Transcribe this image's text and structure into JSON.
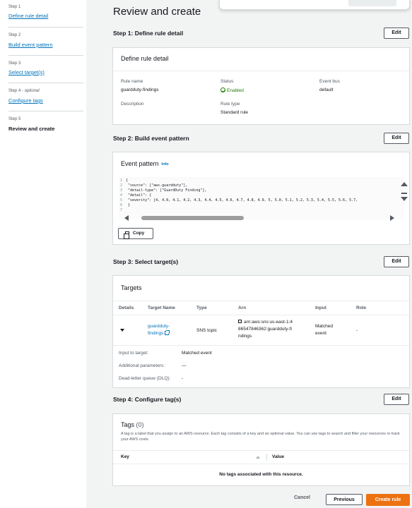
{
  "sidebar": {
    "steps": [
      {
        "num": "Step 1",
        "optional": "",
        "label": "Define rule detail"
      },
      {
        "num": "Step 2",
        "optional": "",
        "label": "Build event pattern"
      },
      {
        "num": "Step 3",
        "optional": "",
        "label": "Select target(s)"
      },
      {
        "num": "Step 4 - ",
        "optional": "optional",
        "label": "Configure tags"
      },
      {
        "num": "Step 5",
        "optional": "",
        "label": "Review and create"
      }
    ]
  },
  "page": {
    "title": "Review and create"
  },
  "edit_label": "Edit",
  "step1": {
    "title": "Step 1: Define rule detail",
    "panel_title": "Define rule detail",
    "rule_name_label": "Rule name",
    "rule_name": "guardduty-findings",
    "status_label": "Status",
    "status": "Enabled",
    "event_bus_label": "Event bus",
    "event_bus": "default",
    "description_label": "Description",
    "rule_type_label": "Rule type",
    "rule_type": "Standard rule"
  },
  "step2": {
    "title": "Step 2: Build event pattern",
    "panel_title": "Event pattern",
    "info": "Info",
    "copy_label": "Copy",
    "code": [
      {
        "n": "1",
        "text": "{"
      },
      {
        "n": "2",
        "text": "  \"source\": [\"aws.guardduty\"],"
      },
      {
        "n": "3",
        "text": "  \"detail-type\": [\"GuardDuty Finding\"],"
      },
      {
        "n": "4",
        "text": "  \"detail\": {"
      },
      {
        "n": "5",
        "text": "    \"severity\": [4, 4.0, 4.1, 4.2, 4.3, 4.4, 4.5, 4.6, 4.7, 4.8, 4.9, 5, 5.0, 5.1, 5.2, 5.3, 5.4, 5.5, 5.6, 5.7,"
      },
      {
        "n": "6",
        "text": "  }"
      },
      {
        "n": "7",
        "text": ""
      }
    ]
  },
  "step3": {
    "title": "Step 3: Select target(s)",
    "panel_title": "Targets",
    "columns": [
      "Details",
      "Target Name",
      "Type",
      "Arn",
      "Input",
      "Role"
    ],
    "row": {
      "target_name_1": "guardduty-",
      "target_name_2": "findings",
      "type": "SNS topic",
      "arn_1": "arn:aws:sns:us-east-1:4",
      "arn_2": "86547846362:guardduty-fi",
      "arn_3": "ndings",
      "input_1": "Matched",
      "input_2": "event",
      "role": "-"
    },
    "details": [
      {
        "label": "Input to target:",
        "value": "Matched event"
      },
      {
        "label": "Additional parameters:",
        "value": "—"
      },
      {
        "label": "Dead-letter queue (DLQ):",
        "value": "-"
      }
    ]
  },
  "step4": {
    "title": "Step 4: Configure tag(s)",
    "panel_title": "Tags",
    "count": "(0)",
    "description": "A tag is a label that you assign to an AWS resource. Each tag consists of a key and an optional value. You can use tags to search and filter your resources or track your AWS costs.",
    "key_col": "Key",
    "value_col": "Value",
    "empty": "No tags associated with this resource."
  },
  "footer": {
    "cancel": "Cancel",
    "previous": "Previous",
    "create": "Create rule"
  },
  "colors": {
    "accent": "#ec7211",
    "link": "#0073bb",
    "success": "#1d8102"
  }
}
